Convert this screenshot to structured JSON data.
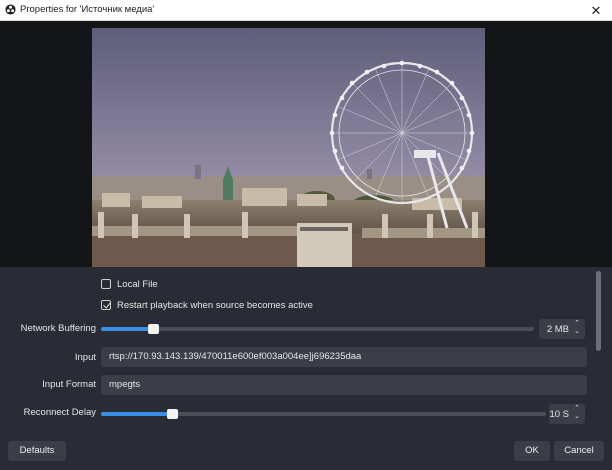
{
  "window": {
    "title": "Properties for 'Источник медиа'"
  },
  "properties": {
    "local_file": {
      "label": "Local File",
      "checked": false
    },
    "restart_playback": {
      "label": "Restart playback when source becomes active",
      "checked": true
    },
    "network_buffering": {
      "label": "Network Buffering",
      "value": "2 MB",
      "level": 0.12
    },
    "input": {
      "label": "Input",
      "value": "rtsp://170.93.143.139/470011e600ef003a004ee]j696235daa"
    },
    "input_format": {
      "label": "Input Format",
      "value": "mpegts"
    },
    "reconnect_delay": {
      "label": "Reconnect Delay",
      "value": "10 S",
      "level": 0.16
    }
  },
  "buttons": {
    "defaults": "Defaults",
    "ok": "OK",
    "cancel": "Cancel"
  },
  "colors": {
    "accent": "#3a8ee6",
    "background": "#1d1f26",
    "panel": "#2a2c35"
  }
}
